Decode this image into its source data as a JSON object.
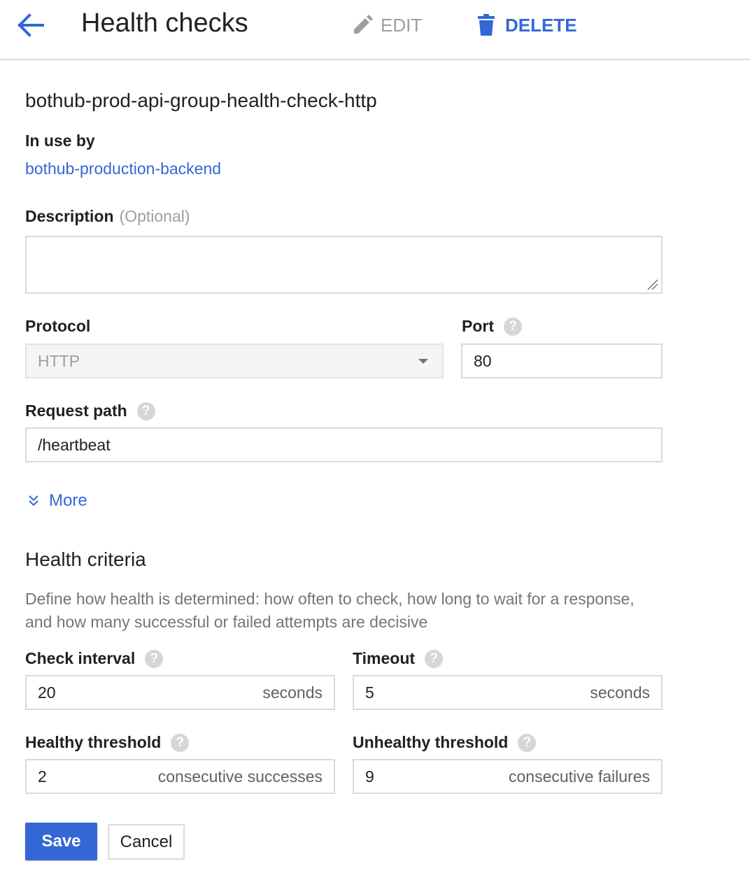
{
  "header": {
    "title": "Health checks",
    "edit_label": "EDIT",
    "delete_label": "DELETE"
  },
  "health_check_name": "bothub-prod-api-group-health-check-http",
  "in_use_by": {
    "label": "In use by",
    "link": "bothub-production-backend"
  },
  "description": {
    "label": "Description",
    "optional": "(Optional)",
    "value": ""
  },
  "protocol": {
    "label": "Protocol",
    "value": "HTTP"
  },
  "port": {
    "label": "Port",
    "value": "80"
  },
  "request_path": {
    "label": "Request path",
    "value": "/heartbeat"
  },
  "more_label": "More",
  "health_criteria": {
    "title": "Health criteria",
    "description": "Define how health is determined: how often to check, how long to wait for a response, and how many successful or failed attempts are decisive",
    "check_interval": {
      "label": "Check interval",
      "value": "20",
      "unit": "seconds"
    },
    "timeout": {
      "label": "Timeout",
      "value": "5",
      "unit": "seconds"
    },
    "healthy_threshold": {
      "label": "Healthy threshold",
      "value": "2",
      "unit": "consecutive successes"
    },
    "unhealthy_threshold": {
      "label": "Unhealthy threshold",
      "value": "9",
      "unit": "consecutive failures"
    }
  },
  "actions": {
    "save_label": "Save",
    "cancel_label": "Cancel"
  },
  "colors": {
    "accent": "#3367d6",
    "disabled_text": "#9e9e9e",
    "border": "#dadada"
  },
  "icons": {
    "back": "arrow-left-icon",
    "edit": "pencil-icon",
    "delete": "trash-icon",
    "help": "help-icon",
    "more": "double-chevron-down-icon"
  }
}
